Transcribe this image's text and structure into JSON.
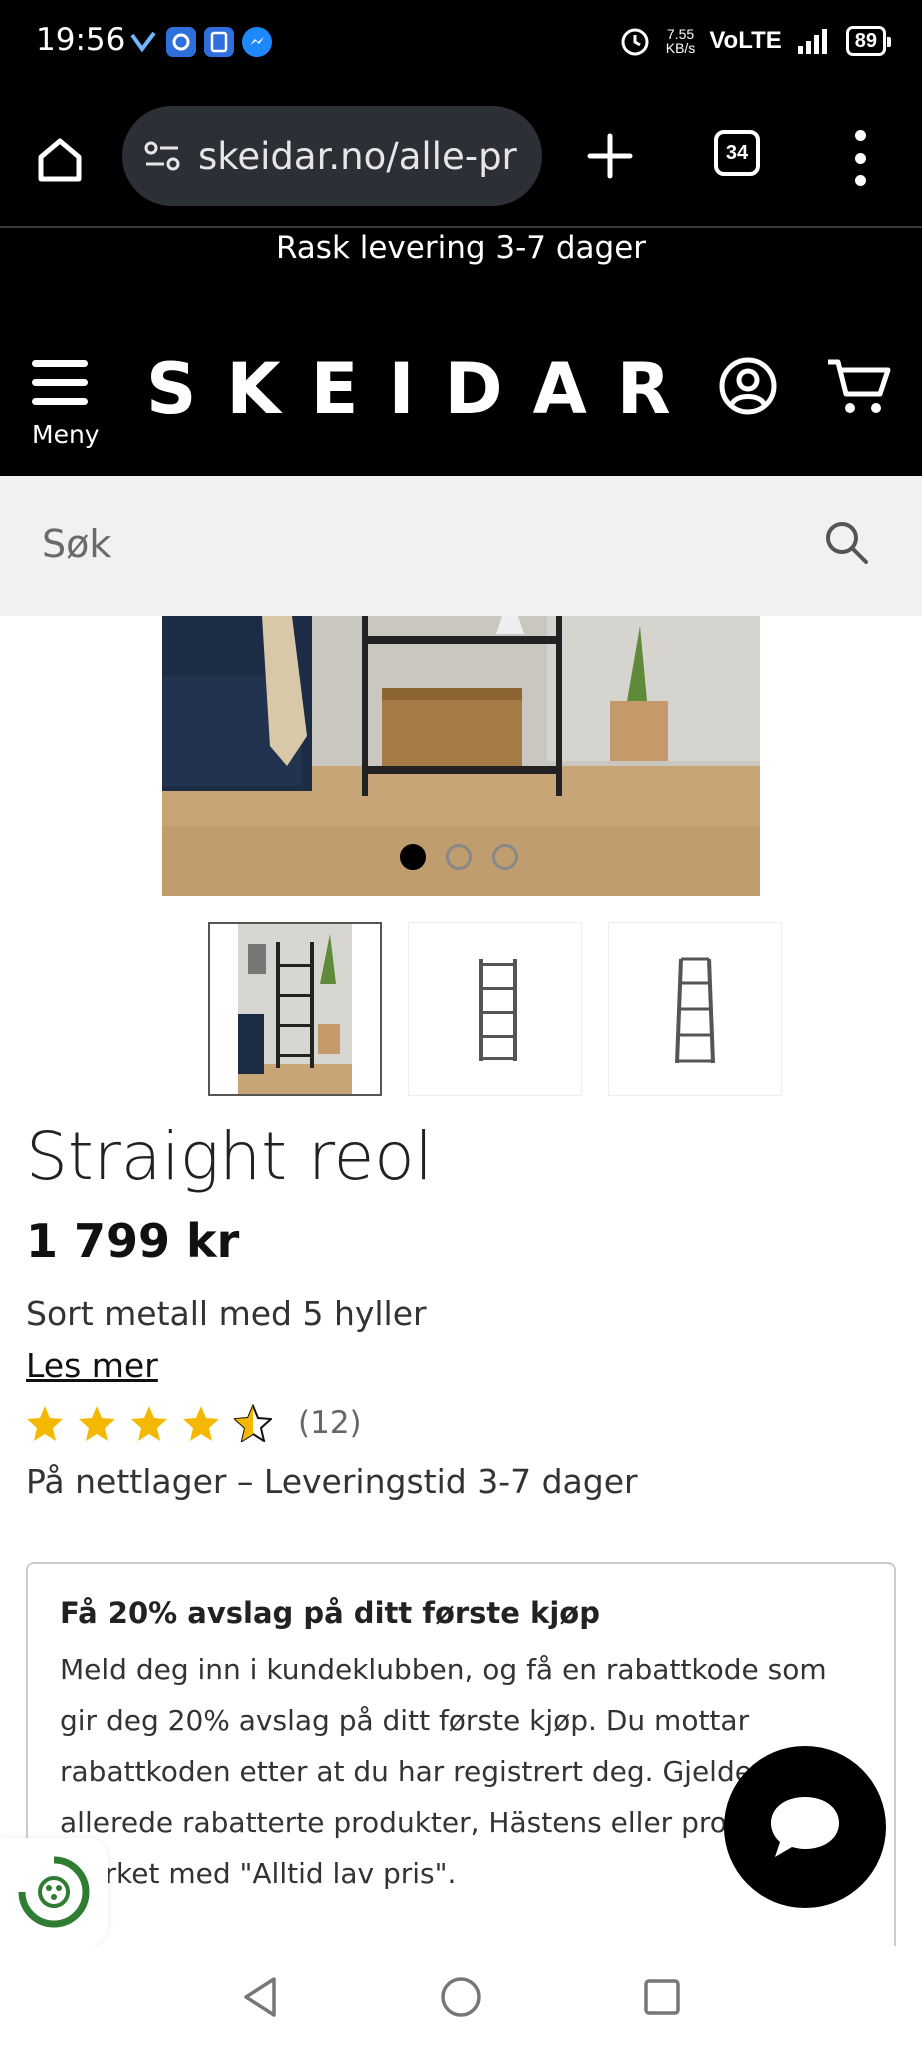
{
  "status": {
    "time": "19:56",
    "speed_value": "7.55",
    "speed_unit": "KB/s",
    "network": "VoLTE",
    "battery": "89"
  },
  "browser": {
    "url": "skeidar.no/alle-pr",
    "tab_count": "34"
  },
  "header": {
    "promo": "Rask levering 3-7 dager",
    "menu_label": "Meny",
    "logo": "SKEIDAR"
  },
  "search": {
    "placeholder": "Søk"
  },
  "product": {
    "title": "Straight reol",
    "price": "1 799 kr",
    "description": "Sort metall med 5 hyller",
    "read_more": "Les mer",
    "rating": 4.5,
    "rating_count": "(12)",
    "stock": "På nettlager – Leveringstid 3-7 dager",
    "images_total": 3,
    "image_index": 1
  },
  "club_offer": {
    "heading": "Få 20% avslag på ditt første kjøp",
    "body": "Meld deg inn i kundeklubben, og få en rabattkode som gir deg 20% avslag på ditt første kjøp. Du mottar rabattkoden etter at du har registrert deg. Gjelder ikke allerede rabatterte produkter, Hästens eller produkter merket med \"Alltid lav pris\"."
  },
  "colors": {
    "header_bg": "#000000",
    "star": "#f5b800",
    "search_bg": "#f1f1f1"
  }
}
